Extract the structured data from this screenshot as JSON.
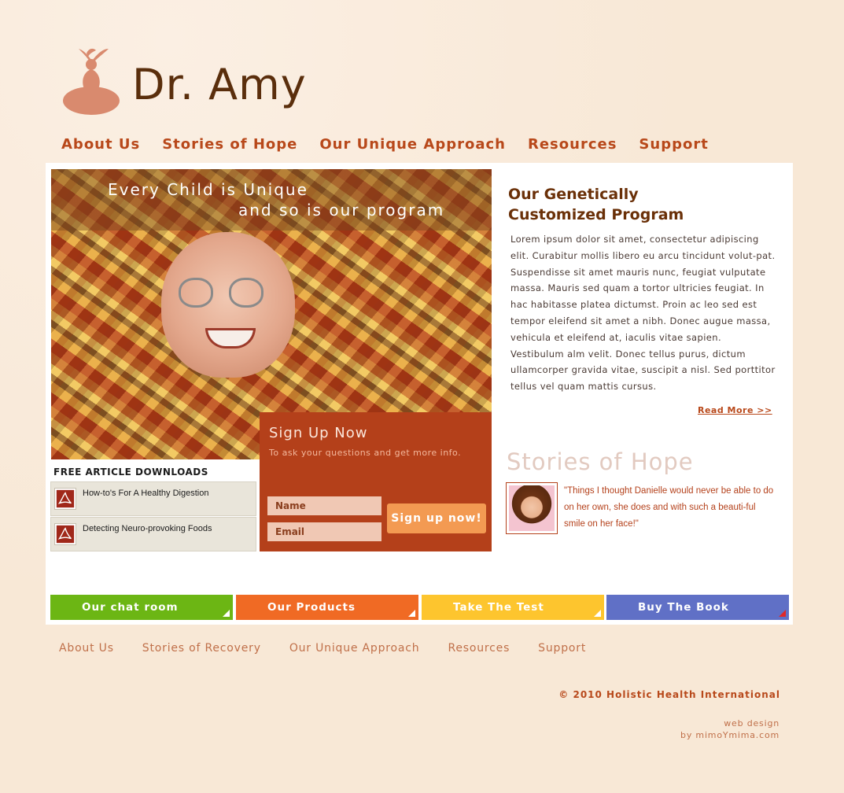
{
  "brand": {
    "name": "Dr. Amy"
  },
  "topnav": [
    "About Us",
    "Stories of Hope",
    "Our Unique Approach",
    "Resources",
    "Support"
  ],
  "hero": {
    "line1": "Every Child is Unique",
    "line2": "and so is our program"
  },
  "signup": {
    "title": "Sign Up Now",
    "subtitle": "To ask your questions and get more info.",
    "name_placeholder": "Name",
    "email_placeholder": "Email",
    "button": "Sign up now!"
  },
  "downloads": {
    "title": "FREE ARTICLE DOWNLOADS",
    "items": [
      "How-to's For A Healthy Digestion",
      "Detecting Neuro-provoking Foods"
    ]
  },
  "program": {
    "title": "Our Genetically Customized Program",
    "body": "Lorem ipsum dolor sit amet, consectetur adipiscing elit. Curabitur mollis libero eu arcu tincidunt volut-pat. Suspendisse sit amet mauris nunc, feugiat vulputate massa. Mauris sed quam a tortor ultricies feugiat. In hac habitasse platea dictumst. Proin ac leo sed est tempor eleifend sit amet a nibh. Donec augue massa, vehicula et eleifend at, iaculis vitae sapien. Vestibulum alm velit. Donec tellus purus, dictum ullamcorper gravida vitae, suscipit a nisl. Sed porttitor tellus vel quam mattis cursus.",
    "read_more": "Read More >>"
  },
  "stories": {
    "title": "Stories of Hope",
    "quote": "\"Things I thought Danielle would never be able to do on her own, she does and with such a beauti-ful smile on her face!\""
  },
  "tiles": [
    {
      "label": "Our chat room",
      "color": "#6cb614"
    },
    {
      "label": "Our Products",
      "color": "#f06a24"
    },
    {
      "label": "Take The Test",
      "color": "#fdc52e"
    },
    {
      "label": "Buy The Book",
      "color": "#6070c6"
    }
  ],
  "footnav": [
    "About Us",
    "Stories of Recovery",
    "Our Unique Approach",
    "Resources",
    "Support"
  ],
  "footer": {
    "copyright": "© 2010 Holistic Health International",
    "credit_line1": "web design",
    "credit_line2": "by mimoYmima.com"
  },
  "colors": {
    "background": "#f8e8d6",
    "accent": "#b8481a",
    "signup_bg": "#b4401a",
    "button": "#f39a52"
  }
}
